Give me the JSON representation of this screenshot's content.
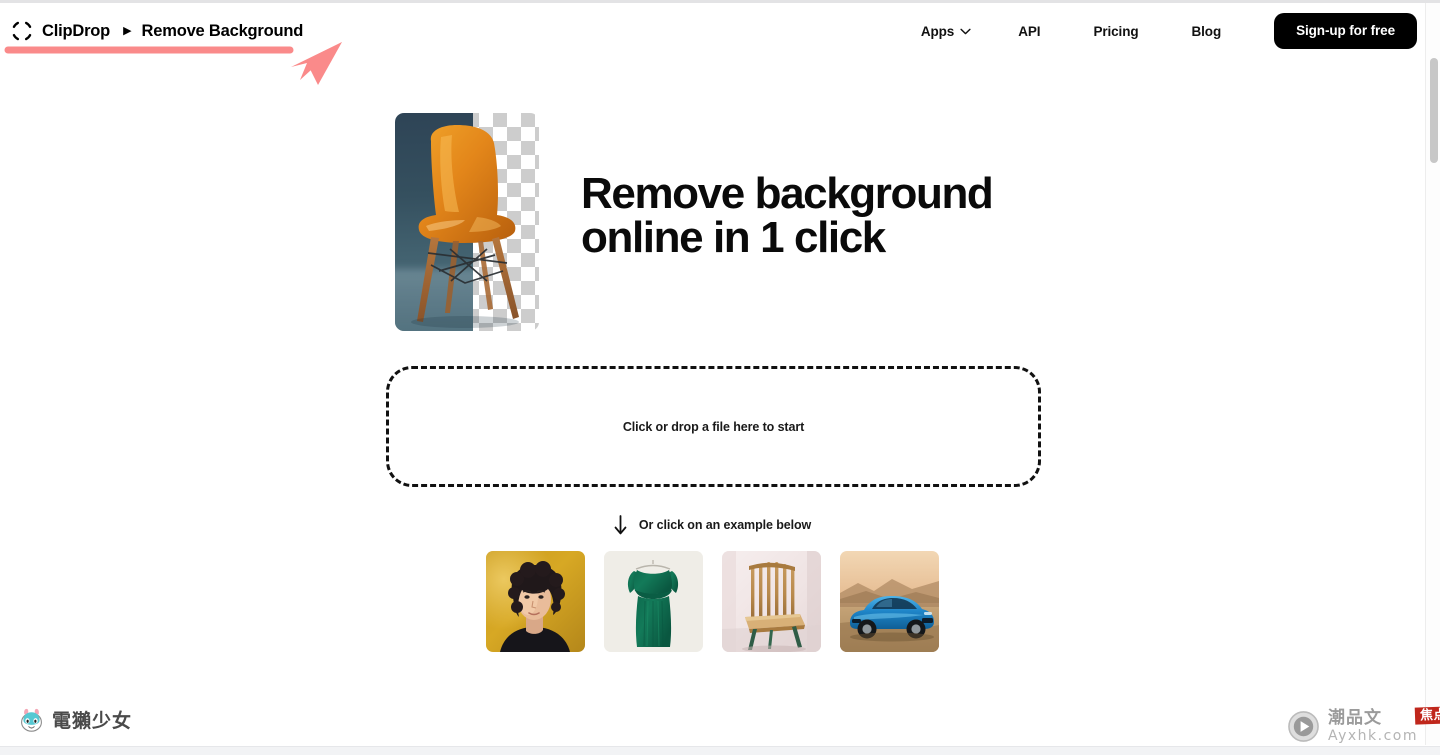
{
  "header": {
    "brand_name": "ClipDrop",
    "separator": "▶",
    "page_name": "Remove Background",
    "logo_icon": "clipdrop-bracket-logo",
    "nav": [
      {
        "label": "Apps",
        "icon": "chevron-down-icon",
        "has_chevron": true
      },
      {
        "label": "API",
        "has_chevron": false
      },
      {
        "label": "Pricing",
        "has_chevron": false
      },
      {
        "label": "Blog",
        "has_chevron": false
      }
    ],
    "signup_label": "Sign-up for free"
  },
  "annotation": {
    "icon": "red-arrow-annotation",
    "color": "#fa8a8a"
  },
  "hero": {
    "title": "Remove background\nonline in 1 click",
    "image_alt": "orange-eames-chair-transparency-preview"
  },
  "dropzone": {
    "label": "Click or drop a file here to start"
  },
  "examples": {
    "hint_icon": "arrow-down-icon",
    "hint_label": "Or click on an example below",
    "items": [
      {
        "name": "example-portrait-woman"
      },
      {
        "name": "example-green-dress"
      },
      {
        "name": "example-wooden-chair"
      },
      {
        "name": "example-blue-sports-car"
      }
    ]
  },
  "watermarks": {
    "left": {
      "icon": "otter-mascot-icon",
      "text": "電獺少女"
    },
    "right": {
      "icon": "play-circle-icon",
      "text_top": "潮品文",
      "badge": "焦点",
      "text_bottom": "Ayxhk.com"
    }
  },
  "scrollbar": {
    "name": "vertical-scrollbar"
  }
}
